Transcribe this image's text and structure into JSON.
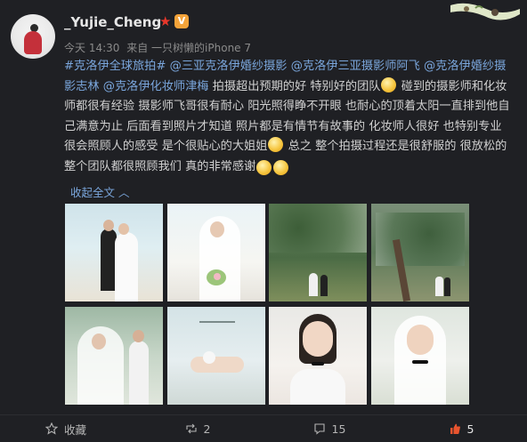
{
  "post": {
    "username": "_Yujie_Cheng",
    "meta": {
      "time": "今天 14:30",
      "source": "来自 一只树懒的iPhone 7"
    },
    "text": {
      "p1_tag": "#克洛伊全球旅拍#",
      "p1_mentions": "@三亚克洛伊婚纱摄影 @克洛伊三亚摄影师阿飞 @克洛伊婚纱摄影志林 @克洛伊化妆师津梅",
      "p2": "拍摄超出预期的好 特别好的团队",
      "p3": "碰到的摄影师和化妆师都很有经验   摄影师飞哥很有耐心 阳光照得睁不开眼 也耐心的顶着太阳一直排到他自己满意为止 后面看到照片才知道 照片都是有情节有故事的 化妆师人很好  也特别专业  很会照顾人的感受 是个很贴心的大姐姐",
      "p4": "总之 整个拍摄过程还是很舒服的 很放松的 整个团队都很照顾我们 真的非常感谢"
    },
    "collapse_label": "收起全文 ︿",
    "photos": [
      {
        "caption": ""
      },
      {
        "caption": ""
      },
      {
        "caption": ""
      },
      {
        "caption": ""
      },
      {
        "caption": ""
      },
      {
        "caption": ""
      },
      {
        "caption": ""
      },
      {
        "caption": ""
      }
    ],
    "actions": {
      "favorite": "收藏",
      "repost": "2",
      "comment": "15",
      "like": "5"
    }
  },
  "colors": {
    "background": "#1f2024",
    "link": "#7aa6dc",
    "like": "#e8542e"
  }
}
